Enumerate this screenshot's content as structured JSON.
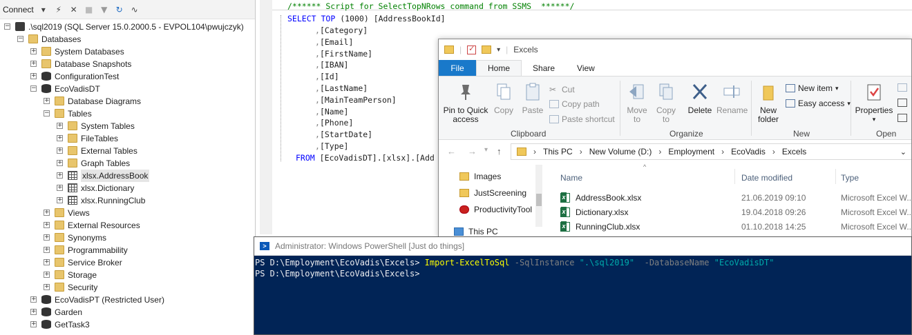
{
  "object_explorer": {
    "toolbar": {
      "connect_label": "Connect"
    },
    "tree": [
      {
        "level": 0,
        "expander": "minus",
        "icon": "server",
        "label": ".\\sql2019 (SQL Server 15.0.2000.5 - EVPOL104\\pwujczyk)"
      },
      {
        "level": 1,
        "expander": "minus",
        "icon": "folder",
        "label": "Databases"
      },
      {
        "level": 2,
        "expander": "plus",
        "icon": "folder",
        "label": "System Databases"
      },
      {
        "level": 2,
        "expander": "plus",
        "icon": "folder",
        "label": "Database Snapshots"
      },
      {
        "level": 2,
        "expander": "plus",
        "icon": "db",
        "label": "ConfigurationTest"
      },
      {
        "level": 2,
        "expander": "minus",
        "icon": "db",
        "label": "EcoVadisDT"
      },
      {
        "level": 3,
        "expander": "plus",
        "icon": "folder",
        "label": "Database Diagrams"
      },
      {
        "level": 3,
        "expander": "minus",
        "icon": "folder",
        "label": "Tables"
      },
      {
        "level": 4,
        "expander": "plus",
        "icon": "folder",
        "label": "System Tables"
      },
      {
        "level": 4,
        "expander": "plus",
        "icon": "folder",
        "label": "FileTables"
      },
      {
        "level": 4,
        "expander": "plus",
        "icon": "folder",
        "label": "External Tables"
      },
      {
        "level": 4,
        "expander": "plus",
        "icon": "folder",
        "label": "Graph Tables"
      },
      {
        "level": 4,
        "expander": "plus",
        "icon": "table",
        "label": "xlsx.AddressBook",
        "selected": true
      },
      {
        "level": 4,
        "expander": "plus",
        "icon": "table",
        "label": "xlsx.Dictionary"
      },
      {
        "level": 4,
        "expander": "plus",
        "icon": "table",
        "label": "xlsx.RunningClub"
      },
      {
        "level": 3,
        "expander": "plus",
        "icon": "folder",
        "label": "Views"
      },
      {
        "level": 3,
        "expander": "plus",
        "icon": "folder",
        "label": "External Resources"
      },
      {
        "level": 3,
        "expander": "plus",
        "icon": "folder",
        "label": "Synonyms"
      },
      {
        "level": 3,
        "expander": "plus",
        "icon": "folder",
        "label": "Programmability"
      },
      {
        "level": 3,
        "expander": "plus",
        "icon": "folder",
        "label": "Service Broker"
      },
      {
        "level": 3,
        "expander": "plus",
        "icon": "folder",
        "label": "Storage"
      },
      {
        "level": 3,
        "expander": "plus",
        "icon": "folder",
        "label": "Security"
      },
      {
        "level": 2,
        "expander": "plus",
        "icon": "db",
        "label": "EcoVadisPT (Restricted User)"
      },
      {
        "level": 2,
        "expander": "plus",
        "icon": "db",
        "label": "Garden"
      },
      {
        "level": 2,
        "expander": "plus",
        "icon": "db",
        "label": "GetTask3"
      }
    ]
  },
  "editor": {
    "comment": "/****** Script for SelectTopNRows command from SSMS  ******/",
    "select_kw": "SELECT",
    "top_kw": "TOP",
    "top_value": "(1000)",
    "first_column": "[AddressBookId]",
    "columns": [
      "[Category]",
      "[Email]",
      "[FirstName]",
      "[IBAN]",
      "[Id]",
      "[LastName]",
      "[MainTeamPerson]",
      "[Name]",
      "[Phone]",
      "[StartDate]",
      "[Type]"
    ],
    "from_kw": "FROM",
    "from_target": "[EcoVadisDT].[xlsx].[Add"
  },
  "explorer": {
    "title": "Excels",
    "tabs": {
      "file": "File",
      "home": "Home",
      "share": "Share",
      "view": "View"
    },
    "ribbon": {
      "pin": "Pin to Quick access",
      "pin_line1": "Pin to Quick",
      "pin_line2": "access",
      "copy": "Copy",
      "paste": "Paste",
      "cut": "Cut",
      "copy_path": "Copy path",
      "paste_shortcut": "Paste shortcut",
      "clipboard_group": "Clipboard",
      "move_to_1": "Move",
      "move_to_2": "to",
      "copy_to_1": "Copy",
      "copy_to_2": "to",
      "delete": "Delete",
      "rename": "Rename",
      "organize_group": "Organize",
      "new_folder_1": "New",
      "new_folder_2": "folder",
      "new_item": "New item",
      "easy_access": "Easy access",
      "new_group": "New",
      "properties": "Properties",
      "open_group": "Open"
    },
    "breadcrumb": [
      "This PC",
      "New Volume (D:)",
      "Employment",
      "EcoVadis",
      "Excels"
    ],
    "nav_items": [
      "Images",
      "JustScreening",
      "ProductivityTool",
      "This PC"
    ],
    "columns": {
      "name": "Name",
      "date_modified": "Date modified",
      "type": "Type"
    },
    "files": [
      {
        "name": "AddressBook.xlsx",
        "date": "21.06.2019 09:10",
        "type": "Microsoft Excel W..."
      },
      {
        "name": "Dictionary.xlsx",
        "date": "19.04.2018 09:26",
        "type": "Microsoft Excel W..."
      },
      {
        "name": "RunningClub.xlsx",
        "date": "01.10.2018 14:25",
        "type": "Microsoft Excel W..."
      }
    ]
  },
  "powershell": {
    "title": "Administrator: Windows PowerShell [Just do things]",
    "prompt": "PS D:\\Employment\\EcoVadis\\Excels>",
    "command": "Import-ExcelToSql",
    "param1": "-SqlInstance",
    "value1": "\".\\sql2019\"",
    "param2": "-DatabaseName",
    "value2": "\"EcoVadisDT\"",
    "prompt2": "PS D:\\Employment\\EcoVadis\\Excels>"
  },
  "colors": {
    "ps_background": "#012456",
    "ribbon_file_tab": "#1979ca",
    "sql_keyword": "#0000ff",
    "sql_comment": "#008000"
  }
}
